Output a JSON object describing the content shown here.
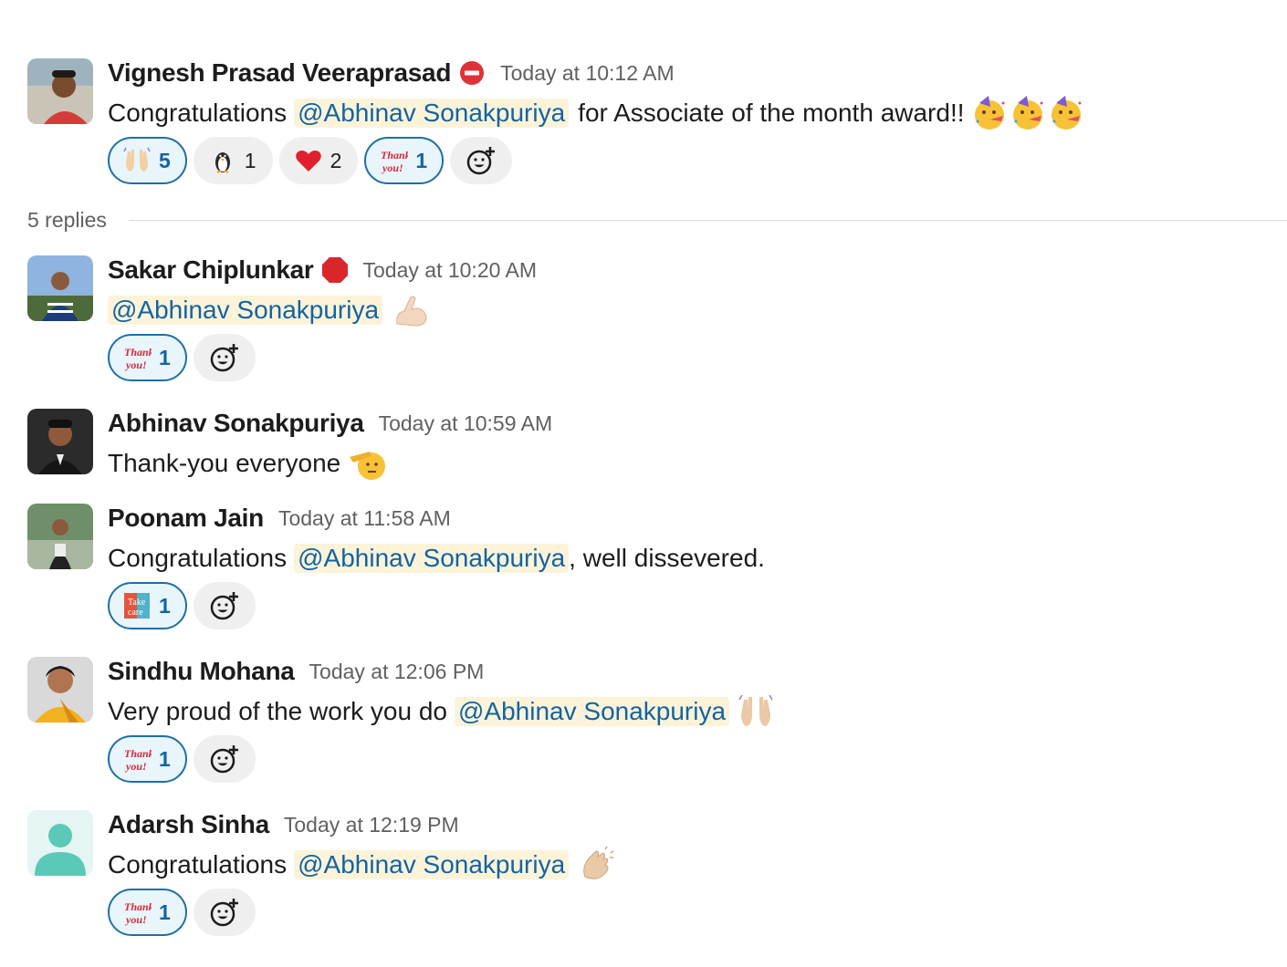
{
  "thread": {
    "parent": {
      "author": "Vignesh Prasad Veeraprasad",
      "status_icon": "no-entry-icon",
      "timestamp": "Today at 10:12 AM",
      "text_before": "Congratulations",
      "mention": "@Abhinav Sonakpuriya",
      "text_after": "for Associate of the month award!!",
      "trailing_emoji": [
        "partying-face",
        "partying-face",
        "partying-face"
      ],
      "reactions": [
        {
          "emoji": "raised-hands",
          "count": "5",
          "mine": true
        },
        {
          "emoji": "penguin",
          "count": "1",
          "mine": false
        },
        {
          "emoji": "red-heart",
          "count": "2",
          "mine": false
        },
        {
          "emoji": "thank-you",
          "count": "1",
          "mine": true
        }
      ]
    },
    "replies_label": "5 replies",
    "replies": [
      {
        "author": "Sakar Chiplunkar",
        "status_icon": "stop-sign-icon",
        "timestamp": "Today at 10:20 AM",
        "mention": "@Abhinav Sonakpuriya",
        "trailing_emoji": "flexed-biceps",
        "reactions": [
          {
            "emoji": "thank-you",
            "count": "1",
            "mine": true
          }
        ]
      },
      {
        "author": "Abhinav Sonakpuriya",
        "timestamp": "Today at 10:59 AM",
        "text": "Thank-you everyone",
        "trailing_emoji": "saluting-face"
      },
      {
        "author": "Poonam Jain",
        "timestamp": "Today at 11:58 AM",
        "text_before": "Congratulations",
        "mention": "@Abhinav Sonakpuriya",
        "text_after": ", well dissevered.",
        "reactions": [
          {
            "emoji": "take-care",
            "count": "1",
            "mine": true
          }
        ]
      },
      {
        "author": "Sindhu Mohana",
        "timestamp": "Today at 12:06 PM",
        "text_before": "Very proud of the work you do",
        "mention": "@Abhinav Sonakpuriya",
        "trailing_emoji": "raised-hands",
        "reactions": [
          {
            "emoji": "thank-you",
            "count": "1",
            "mine": true
          }
        ]
      },
      {
        "author": "Adarsh Sinha",
        "timestamp": "Today at 12:19 PM",
        "text_before": "Congratulations",
        "mention": "@Abhinav Sonakpuriya",
        "trailing_emoji": "clapping-hands",
        "reactions": [
          {
            "emoji": "thank-you",
            "count": "1",
            "mine": true
          }
        ]
      }
    ]
  },
  "colors": {
    "mention_bg": "#fcf3d9",
    "mention_text": "#1264a3",
    "reaction_mine_border": "#1d6fa5",
    "reaction_mine_bg": "#e8f5fa",
    "reaction_bg": "#efefef",
    "timestamp": "#616061"
  }
}
